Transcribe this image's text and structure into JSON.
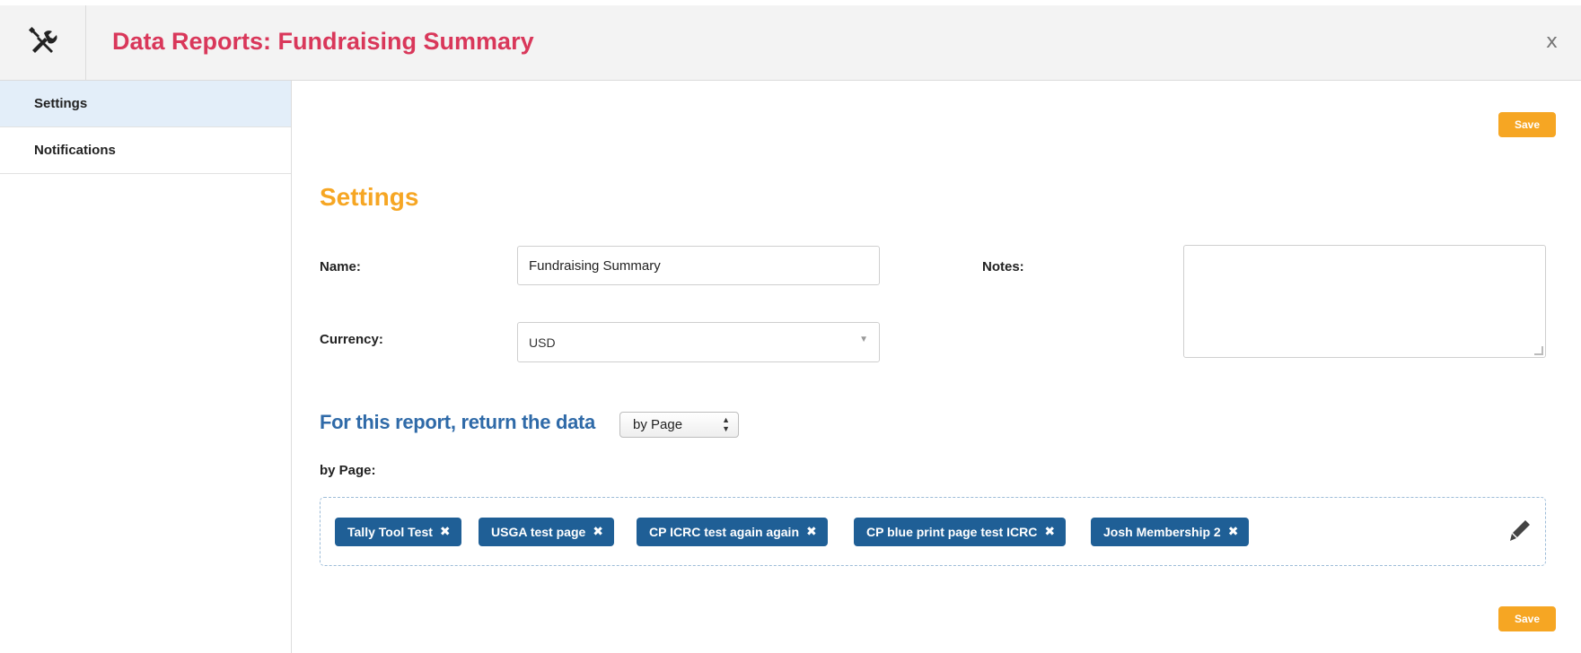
{
  "header": {
    "title": "Data Reports: Fundraising Summary",
    "close_label": "x",
    "icon": "wrench-screwdriver-icon"
  },
  "sidebar": {
    "items": [
      {
        "label": "Settings",
        "active": true
      },
      {
        "label": "Notifications",
        "active": false
      }
    ]
  },
  "toolbar": {
    "save_label": "Save"
  },
  "settings": {
    "title": "Settings",
    "name_label": "Name:",
    "name_value": "Fundraising Summary",
    "currency_label": "Currency:",
    "currency_value": "USD",
    "notes_label": "Notes:",
    "notes_value": ""
  },
  "report": {
    "return_text": "For this report, return the data",
    "return_by_value": "by Page",
    "by_page_label": "by Page:",
    "tags": [
      "Tally Tool Test",
      "USGA test page",
      "CP ICRC test again again",
      "CP blue print page test ICRC",
      "Josh Membership 2"
    ],
    "tag_remove_symbol": "✖"
  },
  "colors": {
    "title_red": "#d9375a",
    "accent_orange": "#f6a623",
    "link_blue": "#2f6aa8",
    "tag_blue": "#1f5f96",
    "sidebar_active": "#e3eef9"
  }
}
